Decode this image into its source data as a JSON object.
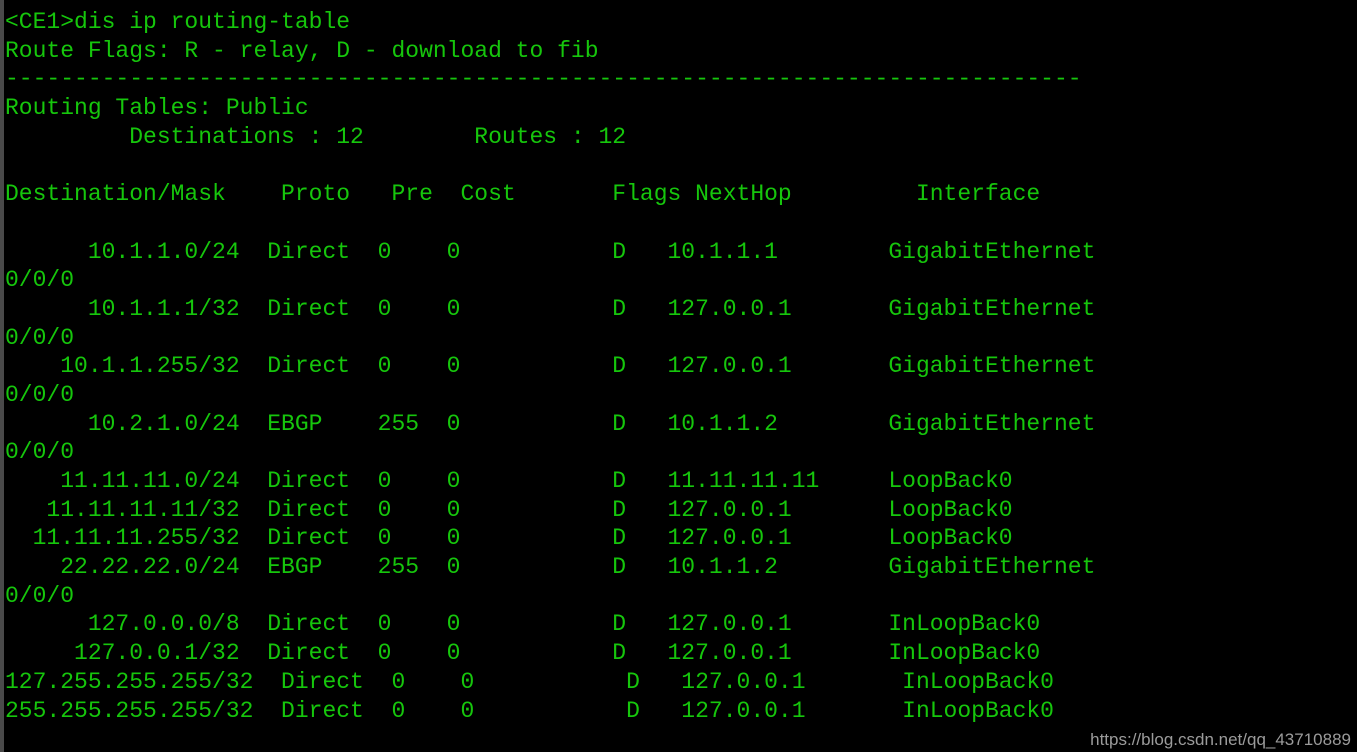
{
  "terminal": {
    "prompt": "<CE1>",
    "command": "dis ip routing-table",
    "prompt_line": "<CE1>dis ip routing-table",
    "route_flags_line": "Route Flags: R - relay, D - download to fib",
    "separator_line": "------------------------------------------------------------------------------",
    "routing_tables_line": "Routing Tables: Public",
    "summary_line": "         Destinations : 12        Routes : 12",
    "destinations_label": "Destinations",
    "destinations_count": "12",
    "routes_label": "Routes",
    "routes_count": "12",
    "colors": {
      "background": "#000000",
      "text": "#16c60c",
      "border": "#4a4a4a",
      "watermark": "#9b9b9b"
    },
    "headers": {
      "destination_mask": "Destination/Mask",
      "proto": "Proto",
      "pre": "Pre",
      "cost": "Cost",
      "flags": "Flags",
      "nexthop": "NextHop",
      "interface": "Interface"
    },
    "header_line": "Destination/Mask    Proto   Pre  Cost       Flags NextHop         Interface",
    "rows": [
      {
        "destination": "10.1.1.0/24",
        "proto": "Direct",
        "pre": "0",
        "cost": "0",
        "flags": "D",
        "nexthop": "10.1.1.1",
        "interface": "GigabitEthernet",
        "interface_cont": "0/0/0",
        "line": "      10.1.1.0/24  Direct  0    0           D   10.1.1.1        GigabitEthernet",
        "cont_line": "0/0/0"
      },
      {
        "destination": "10.1.1.1/32",
        "proto": "Direct",
        "pre": "0",
        "cost": "0",
        "flags": "D",
        "nexthop": "127.0.0.1",
        "interface": "GigabitEthernet",
        "interface_cont": "0/0/0",
        "line": "      10.1.1.1/32  Direct  0    0           D   127.0.0.1       GigabitEthernet",
        "cont_line": "0/0/0"
      },
      {
        "destination": "10.1.1.255/32",
        "proto": "Direct",
        "pre": "0",
        "cost": "0",
        "flags": "D",
        "nexthop": "127.0.0.1",
        "interface": "GigabitEthernet",
        "interface_cont": "0/0/0",
        "line": "    10.1.1.255/32  Direct  0    0           D   127.0.0.1       GigabitEthernet",
        "cont_line": "0/0/0"
      },
      {
        "destination": "10.2.1.0/24",
        "proto": "EBGP",
        "pre": "255",
        "cost": "0",
        "flags": "D",
        "nexthop": "10.1.1.2",
        "interface": "GigabitEthernet",
        "interface_cont": "0/0/0",
        "line": "      10.2.1.0/24  EBGP    255  0           D   10.1.1.2        GigabitEthernet",
        "cont_line": "0/0/0"
      },
      {
        "destination": "11.11.11.0/24",
        "proto": "Direct",
        "pre": "0",
        "cost": "0",
        "flags": "D",
        "nexthop": "11.11.11.11",
        "interface": "LoopBack0",
        "interface_cont": null,
        "line": "    11.11.11.0/24  Direct  0    0           D   11.11.11.11     LoopBack0",
        "cont_line": null
      },
      {
        "destination": "11.11.11.11/32",
        "proto": "Direct",
        "pre": "0",
        "cost": "0",
        "flags": "D",
        "nexthop": "127.0.0.1",
        "interface": "LoopBack0",
        "interface_cont": null,
        "line": "   11.11.11.11/32  Direct  0    0           D   127.0.0.1       LoopBack0",
        "cont_line": null
      },
      {
        "destination": "11.11.11.255/32",
        "proto": "Direct",
        "pre": "0",
        "cost": "0",
        "flags": "D",
        "nexthop": "127.0.0.1",
        "interface": "LoopBack0",
        "interface_cont": null,
        "line": "  11.11.11.255/32  Direct  0    0           D   127.0.0.1       LoopBack0",
        "cont_line": null
      },
      {
        "destination": "22.22.22.0/24",
        "proto": "EBGP",
        "pre": "255",
        "cost": "0",
        "flags": "D",
        "nexthop": "10.1.1.2",
        "interface": "GigabitEthernet",
        "interface_cont": "0/0/0",
        "line": "    22.22.22.0/24  EBGP    255  0           D   10.1.1.2        GigabitEthernet",
        "cont_line": "0/0/0"
      },
      {
        "destination": "127.0.0.0/8",
        "proto": "Direct",
        "pre": "0",
        "cost": "0",
        "flags": "D",
        "nexthop": "127.0.0.1",
        "interface": "InLoopBack0",
        "interface_cont": null,
        "line": "      127.0.0.0/8  Direct  0    0           D   127.0.0.1       InLoopBack0",
        "cont_line": null
      },
      {
        "destination": "127.0.0.1/32",
        "proto": "Direct",
        "pre": "0",
        "cost": "0",
        "flags": "D",
        "nexthop": "127.0.0.1",
        "interface": "InLoopBack0",
        "interface_cont": null,
        "line": "     127.0.0.1/32  Direct  0    0           D   127.0.0.1       InLoopBack0",
        "cont_line": null
      },
      {
        "destination": "127.255.255.255/32",
        "proto": "Direct",
        "pre": "0",
        "cost": "0",
        "flags": "D",
        "nexthop": "127.0.0.1",
        "interface": "InLoopBack0",
        "interface_cont": null,
        "line": "127.255.255.255/32  Direct  0    0           D   127.0.0.1       InLoopBack0",
        "cont_line": null
      },
      {
        "destination": "255.255.255.255/32",
        "proto": "Direct",
        "pre": "0",
        "cost": "0",
        "flags": "D",
        "nexthop": "127.0.0.1",
        "interface": "InLoopBack0",
        "interface_cont": null,
        "line": "255.255.255.255/32  Direct  0    0           D   127.0.0.1       InLoopBack0",
        "cont_line": null
      }
    ]
  },
  "watermark": {
    "text": "https://blog.csdn.net/qq_43710889"
  }
}
